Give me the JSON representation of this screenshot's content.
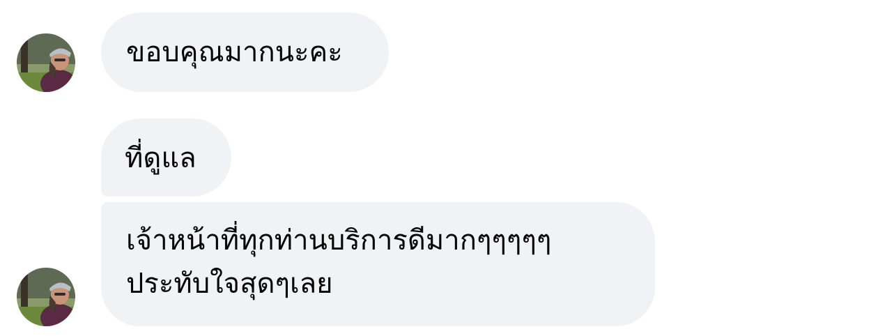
{
  "messages": [
    {
      "text": "ขอบคุณมากนะคะ"
    },
    {
      "text": "ที่ดูแล"
    },
    {
      "lines": [
        "เจ้าหน้าที่ทุกท่านบริการดีมากๆๆๆๆๆ",
        "ประทับใจสุดๆเลย"
      ]
    }
  ],
  "colors": {
    "bubble_background": "#f0f2f5",
    "text": "#050505",
    "page_background": "#ffffff"
  }
}
